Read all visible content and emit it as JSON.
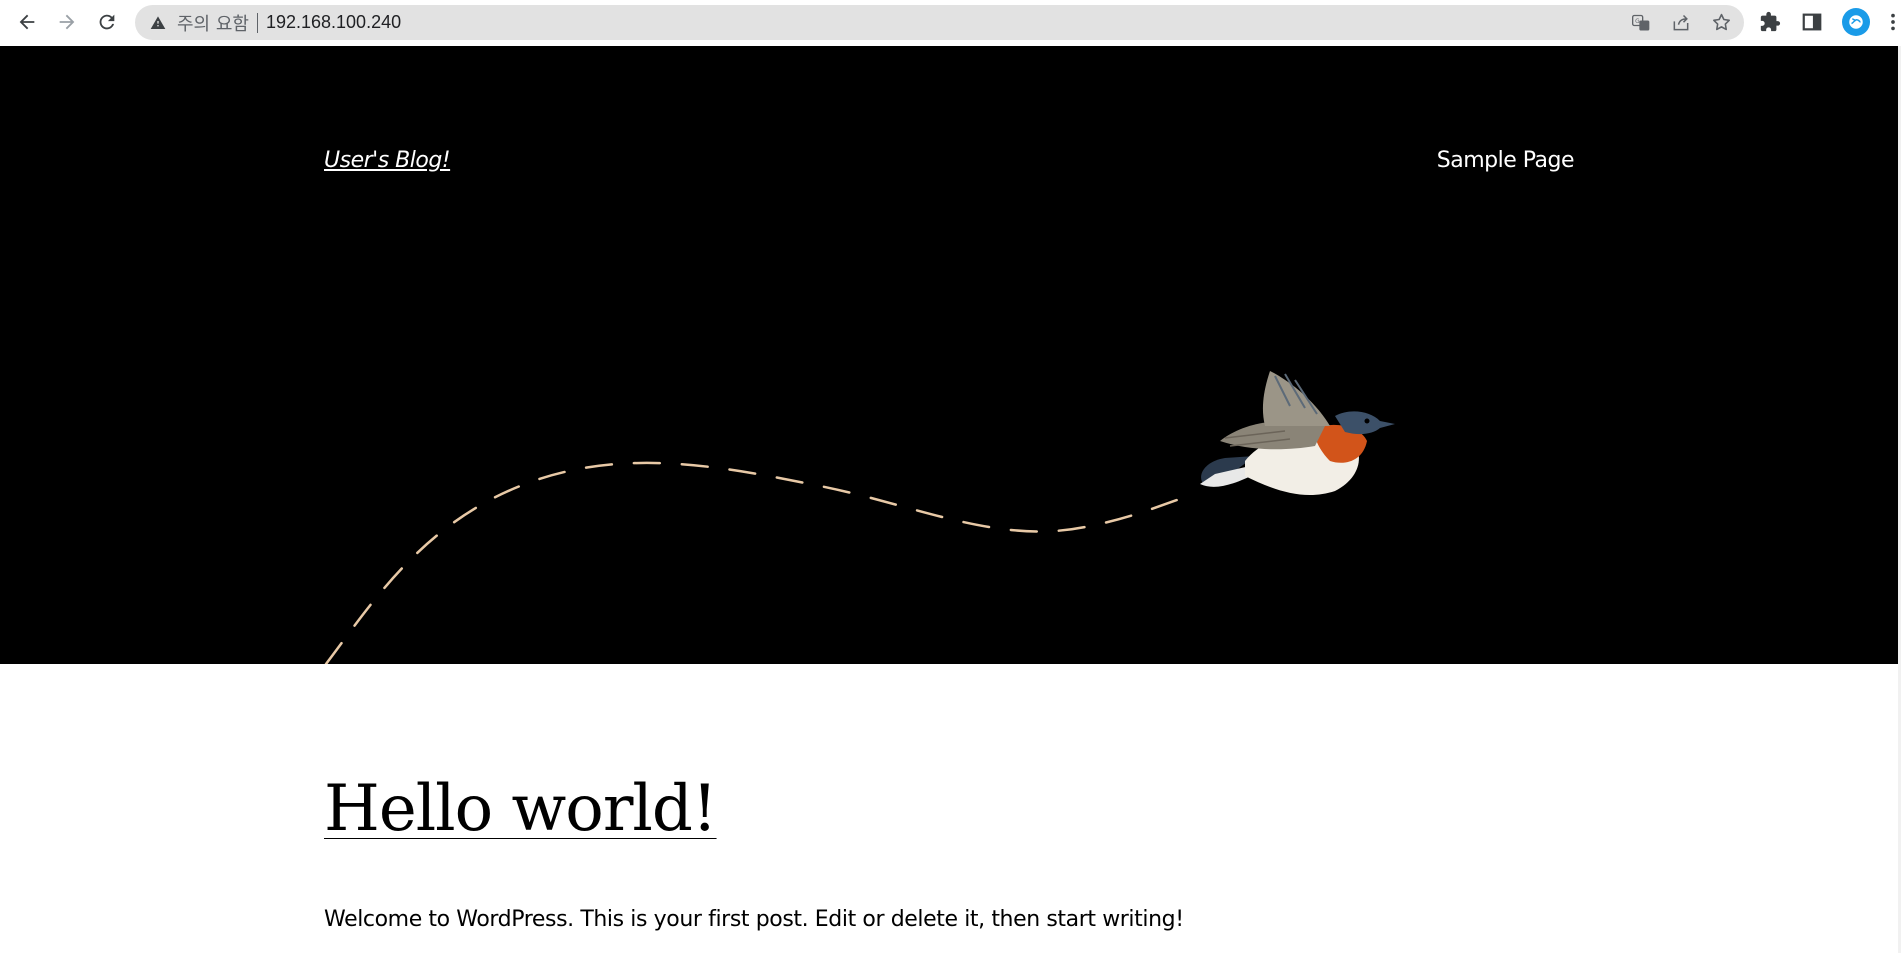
{
  "browser": {
    "status_text": "주의 요함",
    "url": "192.168.100.240",
    "icons": {
      "back": "arrow-left-icon",
      "forward": "arrow-right-icon",
      "reload": "reload-icon",
      "warning": "warning-triangle-icon",
      "translate": "translate-icon",
      "share": "share-icon",
      "bookmark": "star-icon",
      "extensions": "puzzle-icon",
      "side_panel": "side-panel-icon",
      "profile": "profile-avatar-icon",
      "menu": "kebab-menu-icon"
    }
  },
  "site": {
    "title": "User's Blog!",
    "nav": [
      "Sample Page"
    ],
    "colors": {
      "header_bg": "#000000",
      "text": "#ffffff",
      "path": "#e8c9a6"
    }
  },
  "post": {
    "title": "Hello world!",
    "excerpt": "Welcome to WordPress. This is your first post. Edit or delete it, then start writing!"
  }
}
